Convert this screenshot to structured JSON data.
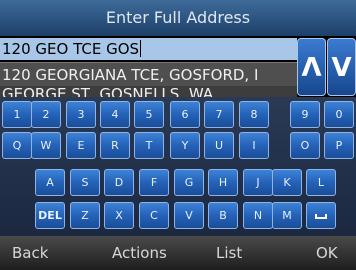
{
  "title": "Enter Full Address",
  "input": {
    "value": "120 GEO TCE GOS"
  },
  "suggestions": [
    "120 GEORGIANA TCE, GOSFORD, I",
    "GEORGE ST, GOSNELLS, WA"
  ],
  "arrows": {
    "up": "Λ",
    "down": "V"
  },
  "keyboard": {
    "row1": [
      "1",
      "2",
      "3",
      "4",
      "5",
      "6",
      "7",
      "8",
      "9",
      "0"
    ],
    "row2": [
      "Q",
      "W",
      "E",
      "R",
      "T",
      "Y",
      "U",
      "I",
      "O",
      "P"
    ],
    "row3": [
      "A",
      "S",
      "D",
      "F",
      "G",
      "H",
      "J",
      "K",
      "L"
    ],
    "row4": [
      "DEL",
      "Z",
      "X",
      "C",
      "V",
      "B",
      "N",
      "M"
    ],
    "space_icon": "space-icon"
  },
  "softkeys": {
    "back": "Back",
    "actions": "Actions",
    "list": "List",
    "ok": "OK"
  }
}
